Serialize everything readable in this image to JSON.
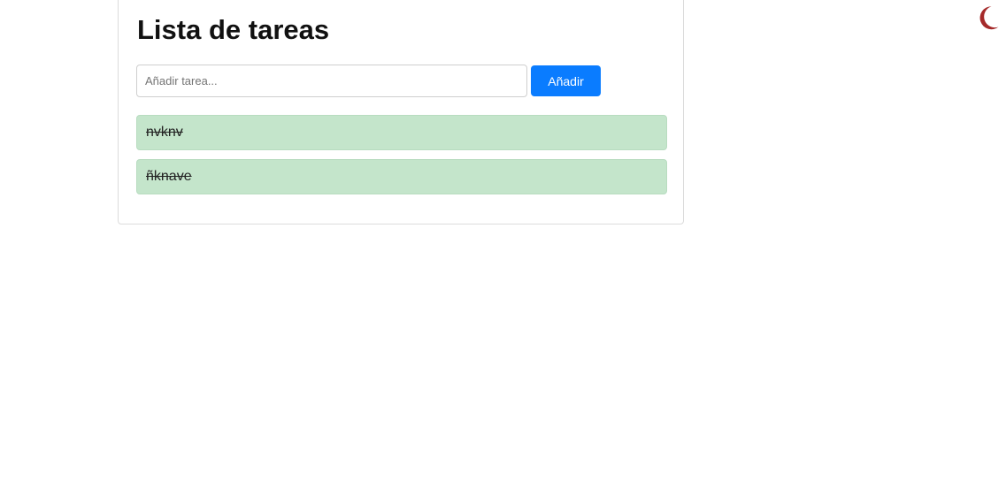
{
  "header": {
    "title": "Lista de tareas"
  },
  "add_form": {
    "placeholder": "Añadir tarea...",
    "value": "",
    "button_label": "Añadir"
  },
  "tasks": [
    {
      "text": "nvknv",
      "completed": true
    },
    {
      "text": "ñknave",
      "completed": true
    }
  ],
  "theme_toggle": {
    "icon": "moon-icon",
    "color": "#a52a2a"
  },
  "colors": {
    "accent": "#0a7cff",
    "completed_task_bg": "#c4e5cb"
  }
}
